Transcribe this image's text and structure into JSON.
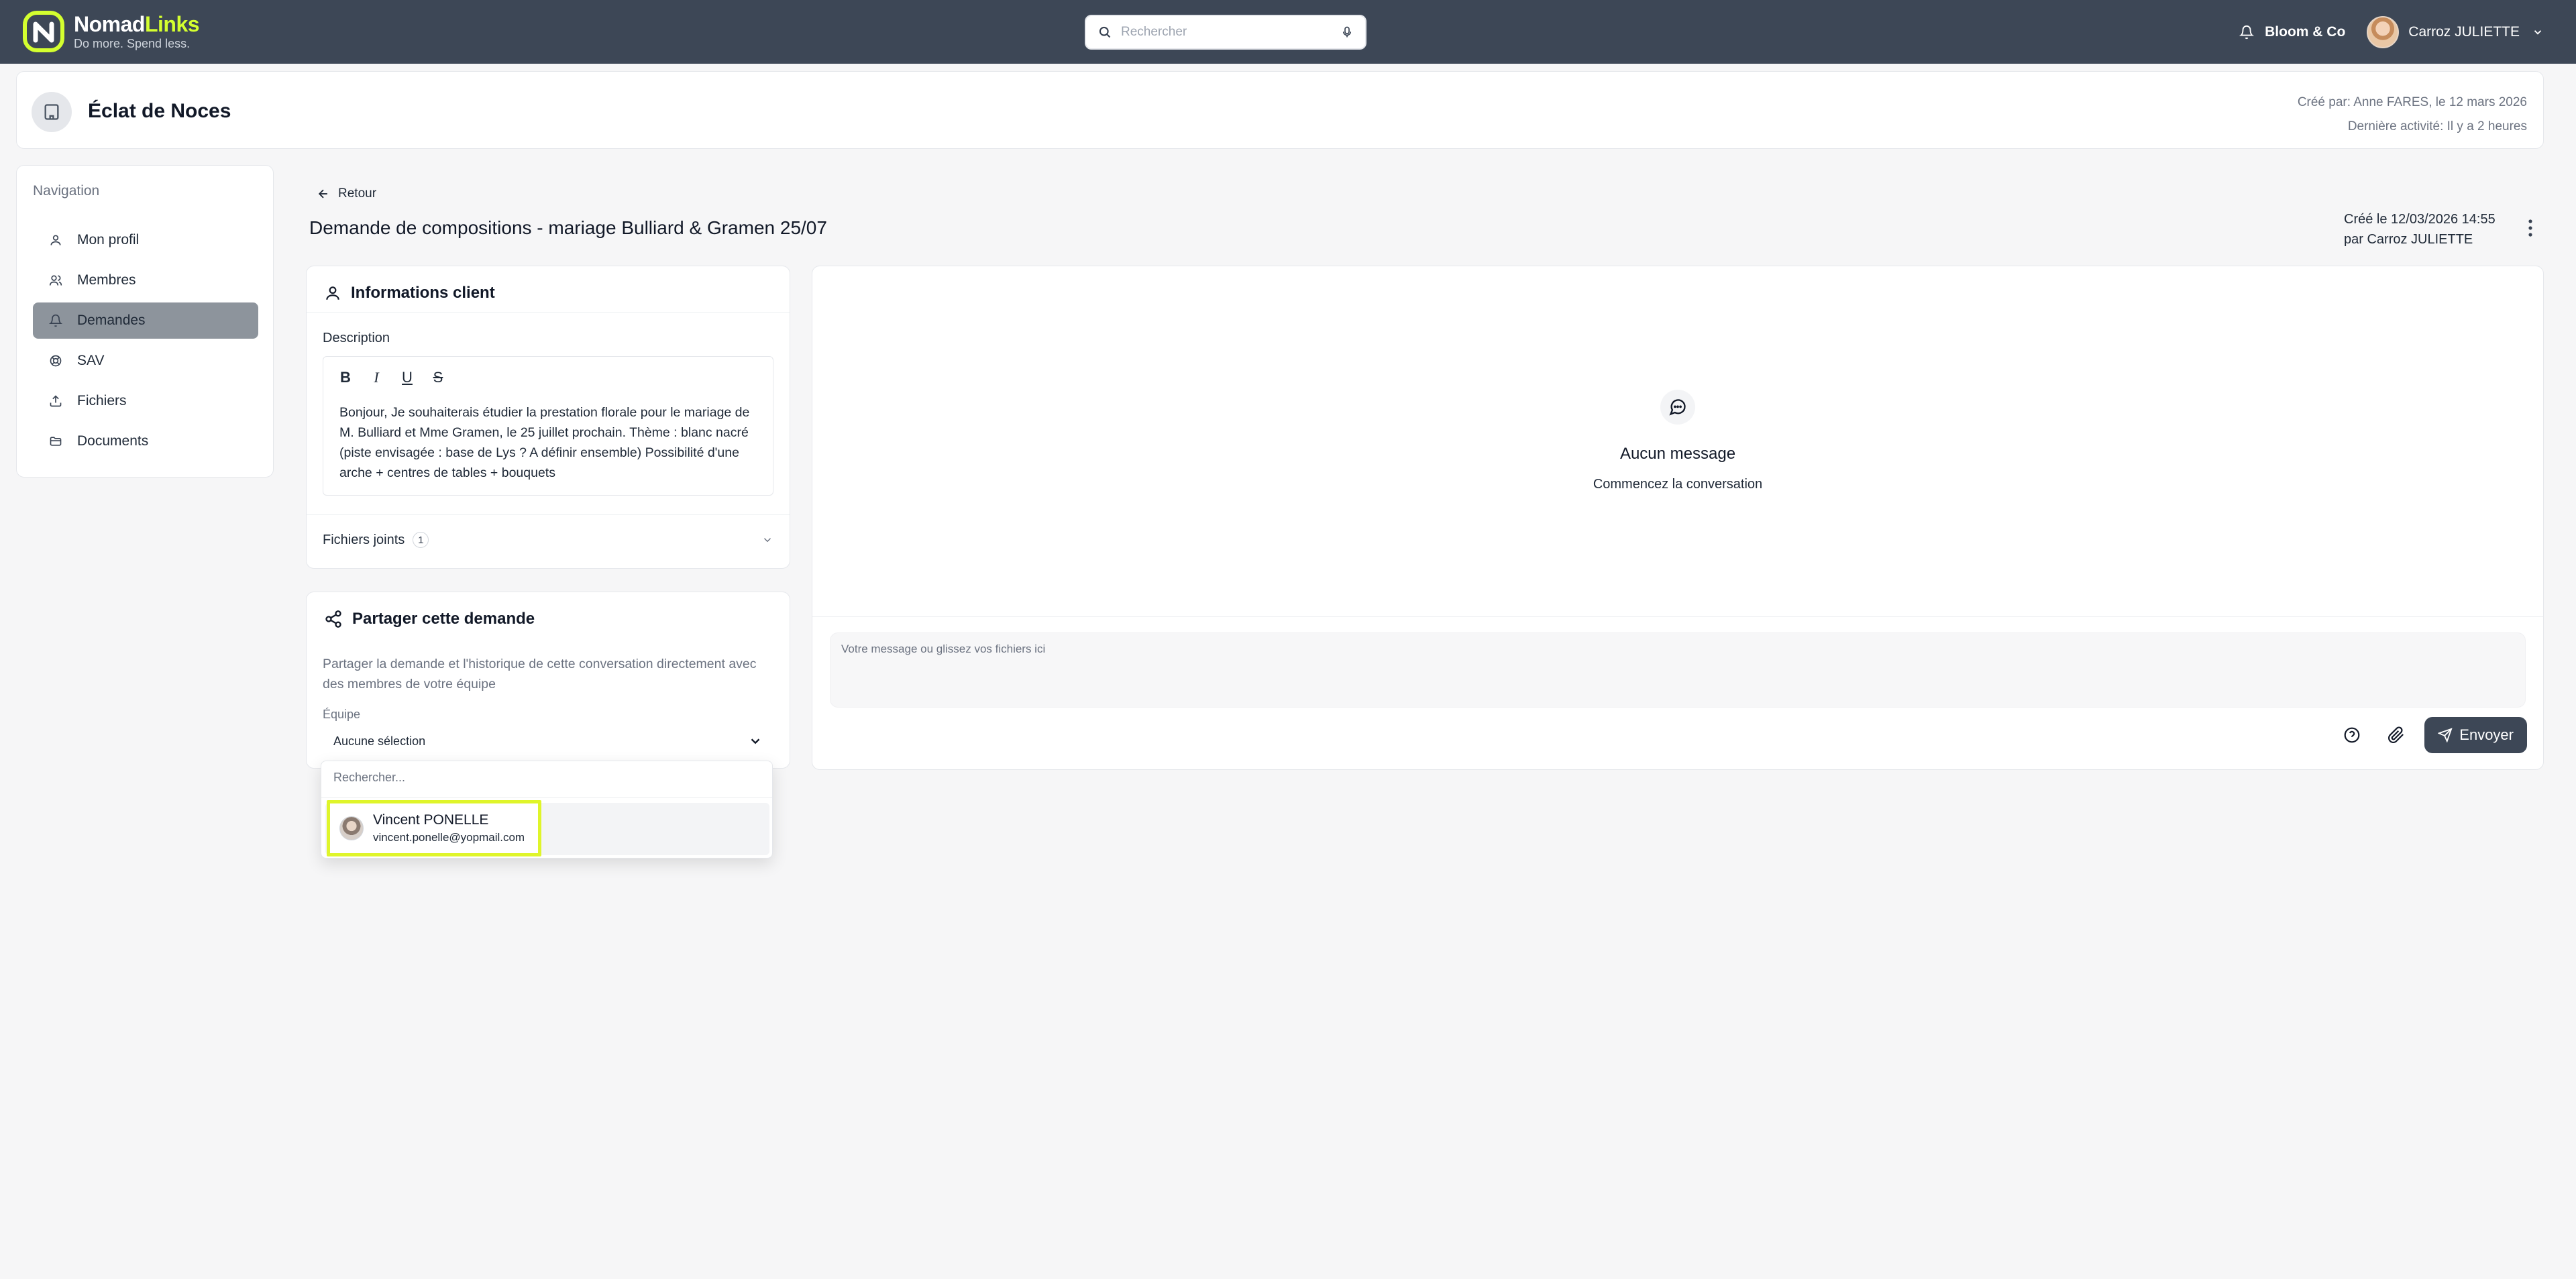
{
  "brand": {
    "name_part1": "Nomad",
    "name_part2": "Links",
    "tagline": "Do more. Spend less.",
    "accent_color": "#d4ff2f",
    "bar_color": "#3d4756"
  },
  "search": {
    "placeholder": "Rechercher",
    "icon": "search-icon",
    "mic_icon": "microphone-icon"
  },
  "topbar": {
    "organization": "Bloom & Co",
    "user_name": "Carroz JULIETTE"
  },
  "header": {
    "company_name": "Éclat de Noces",
    "created_by": "Créé par: Anne FARES, le 12 mars 2026",
    "last_activity": "Dernière activité: Il y a 2 heures"
  },
  "sidebar": {
    "title": "Navigation",
    "items": [
      {
        "label": "Mon profil",
        "icon": "user-icon",
        "active": false
      },
      {
        "label": "Membres",
        "icon": "users-icon",
        "active": false
      },
      {
        "label": "Demandes",
        "icon": "bell-icon",
        "active": true
      },
      {
        "label": "SAV",
        "icon": "lifebuoy-icon",
        "active": false
      },
      {
        "label": "Fichiers",
        "icon": "upload-icon",
        "active": false
      },
      {
        "label": "Documents",
        "icon": "folder-icon",
        "active": false
      }
    ]
  },
  "request": {
    "back_label": "Retour",
    "title": "Demande de compositions - mariage Bulliard & Gramen 25/07",
    "created_line1": "Créé le 12/03/2026 14:55",
    "created_line2": "par Carroz JULIETTE"
  },
  "client_info": {
    "heading": "Informations client",
    "description_label": "Description",
    "toolbar": {
      "bold": "B",
      "italic": "I",
      "underline": "U",
      "strike": "S"
    },
    "description_text": "Bonjour, Je souhaiterais étudier la prestation florale pour le mariage de M. Bulliard et Mme Gramen, le 25 juillet prochain. Thème : blanc nacré (piste envisagée : base de Lys ? A définir ensemble) Possibilité d'une arche + centres de tables + bouquets",
    "attachments_label": "Fichiers joints",
    "attachments_count": "1"
  },
  "share": {
    "heading": "Partager cette demande",
    "description": "Partager la demande et l'historique de cette conversation directement avec des membres de votre équipe",
    "team_label": "Équipe",
    "selected_value": "Aucune sélection",
    "dropdown_search_placeholder": "Rechercher...",
    "options": [
      {
        "name": "Vincent PONELLE",
        "email": "vincent.ponelle@yopmail.com"
      }
    ],
    "highlight_color": "#dff52a"
  },
  "chat": {
    "empty_title": "Aucun message",
    "empty_subtitle": "Commencez la conversation",
    "input_placeholder": "Votre message ou glissez vos fichiers ici",
    "send_label": "Envoyer"
  }
}
